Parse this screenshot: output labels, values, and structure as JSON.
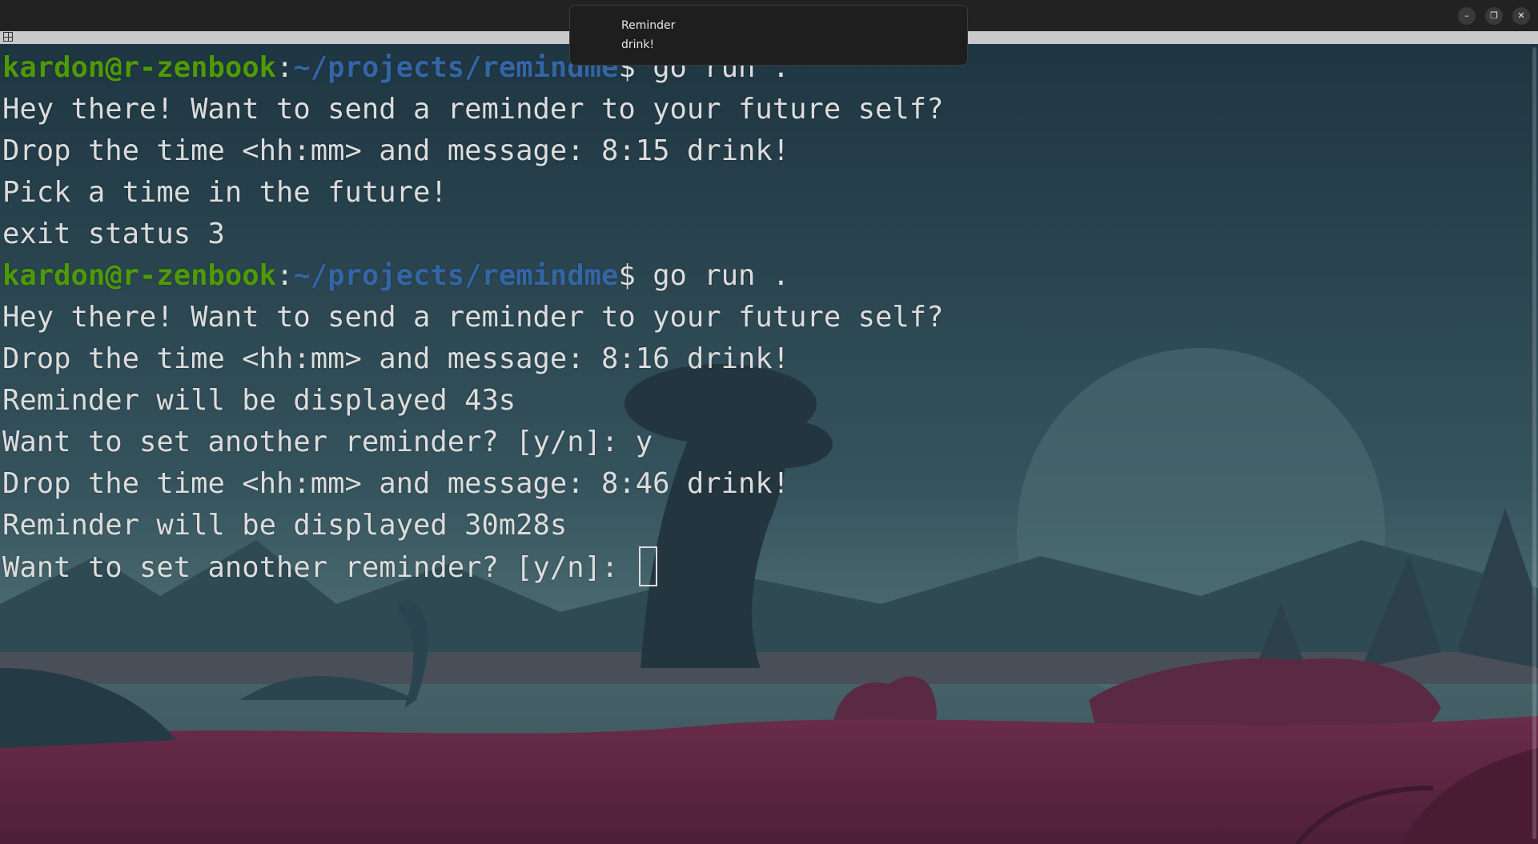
{
  "window": {
    "controls": {
      "minimize": "–",
      "maximize": "❐",
      "close": "✕"
    }
  },
  "notification": {
    "title": "Reminder",
    "body": "drink!"
  },
  "terminal": {
    "colors": {
      "user": "#4e9a06",
      "path": "#3465a4",
      "text": "#dcdcdc"
    },
    "prompt": {
      "user_host": "kardon@r-zenbook",
      "colon": ":",
      "path": "~/projects/remindme",
      "dollar": "$ "
    },
    "lines": [
      {
        "type": "prompt",
        "command": "go run ."
      },
      {
        "type": "output",
        "text": "Hey there! Want to send a reminder to your future self?"
      },
      {
        "type": "output",
        "text": "Drop the time <hh:mm> and message: 8:15 drink!"
      },
      {
        "type": "output",
        "text": "Pick a time in the future!"
      },
      {
        "type": "output",
        "text": "exit status 3"
      },
      {
        "type": "prompt",
        "command": "go run ."
      },
      {
        "type": "output",
        "text": "Hey there! Want to send a reminder to your future self?"
      },
      {
        "type": "output",
        "text": "Drop the time <hh:mm> and message: 8:16 drink!"
      },
      {
        "type": "output",
        "text": "Reminder will be displayed 43s"
      },
      {
        "type": "output",
        "text": "Want to set another reminder? [y/n]: y"
      },
      {
        "type": "output",
        "text": "Drop the time <hh:mm> and message: 8:46 drink!"
      },
      {
        "type": "output",
        "text": "Reminder will be displayed 30m28s"
      },
      {
        "type": "input",
        "text": "Want to set another reminder? [y/n]: "
      }
    ]
  }
}
